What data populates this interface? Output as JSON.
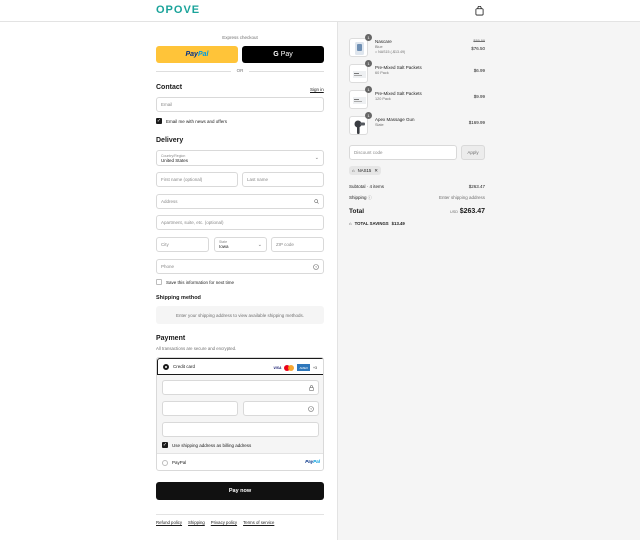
{
  "brand": {
    "logo_text": "OPOVE",
    "accent": "#1aa39a"
  },
  "express": {
    "label": "Express checkout",
    "paypal_a": "Pay",
    "paypal_b": "Pal",
    "gpay": "Pay",
    "gpay_g": "G",
    "or": "OR"
  },
  "contact": {
    "title": "Contact",
    "signin": "Sign in",
    "email_placeholder": "Email",
    "news_label": "Email me with news and offers",
    "news_checked": true
  },
  "delivery": {
    "title": "Delivery",
    "country_label": "Country/Region",
    "country_value": "United States",
    "first_name": "First name (optional)",
    "last_name": "Last name",
    "address": "Address",
    "apartment": "Apartment, suite, etc. (optional)",
    "city": "City",
    "state_label": "State",
    "state_value": "Iowa",
    "zip": "ZIP code",
    "phone": "Phone",
    "save_label": "Save this information for next time"
  },
  "shipping": {
    "title": "Shipping method",
    "info": "Enter your shipping address to view available shipping methods."
  },
  "payment": {
    "title": "Payment",
    "subtitle": "All transactions are secure and encrypted.",
    "credit_card": "Credit card",
    "card_logos": {
      "visa": "VISA",
      "amex": "AMEX",
      "more": "+3"
    },
    "billing_label": "Use shipping address as billing address",
    "paypal_option": "PayPal",
    "paypal_logo_a": "Pay",
    "paypal_logo_b": "Pal"
  },
  "pay_now": "Pay now",
  "footer": {
    "links": [
      "Refund policy",
      "Shipping",
      "Privacy policy",
      "Terms of service"
    ]
  },
  "cart": {
    "items": [
      {
        "name": "Nascare",
        "sub": "Blue",
        "discount": "NAS15 (-$13.49)",
        "old_price": "$89.99",
        "price": "$76.50",
        "qty": "1"
      },
      {
        "name": "Pre-Mixed Salt Packets",
        "sub": "60 Pack",
        "discount": "",
        "old_price": "",
        "price": "$6.99",
        "qty": "1"
      },
      {
        "name": "Pre-Mixed Salt Packets",
        "sub": "120 Pack",
        "discount": "",
        "old_price": "",
        "price": "$9.99",
        "qty": "1"
      },
      {
        "name": "Apex Massage Gun",
        "sub": "Slate",
        "discount": "",
        "old_price": "",
        "price": "$169.99",
        "qty": "1"
      }
    ],
    "discount_placeholder": "Discount code",
    "apply": "Apply",
    "applied_code": "NAS15",
    "subtotal_label": "Subtotal · 4 items",
    "subtotal": "$263.47",
    "shipping_label": "Shipping",
    "shipping_value": "Enter shipping address",
    "total_label": "Total",
    "currency": "USD",
    "total": "$263.47",
    "savings_label": "TOTAL SAVINGS",
    "savings_value": "$13.49"
  }
}
